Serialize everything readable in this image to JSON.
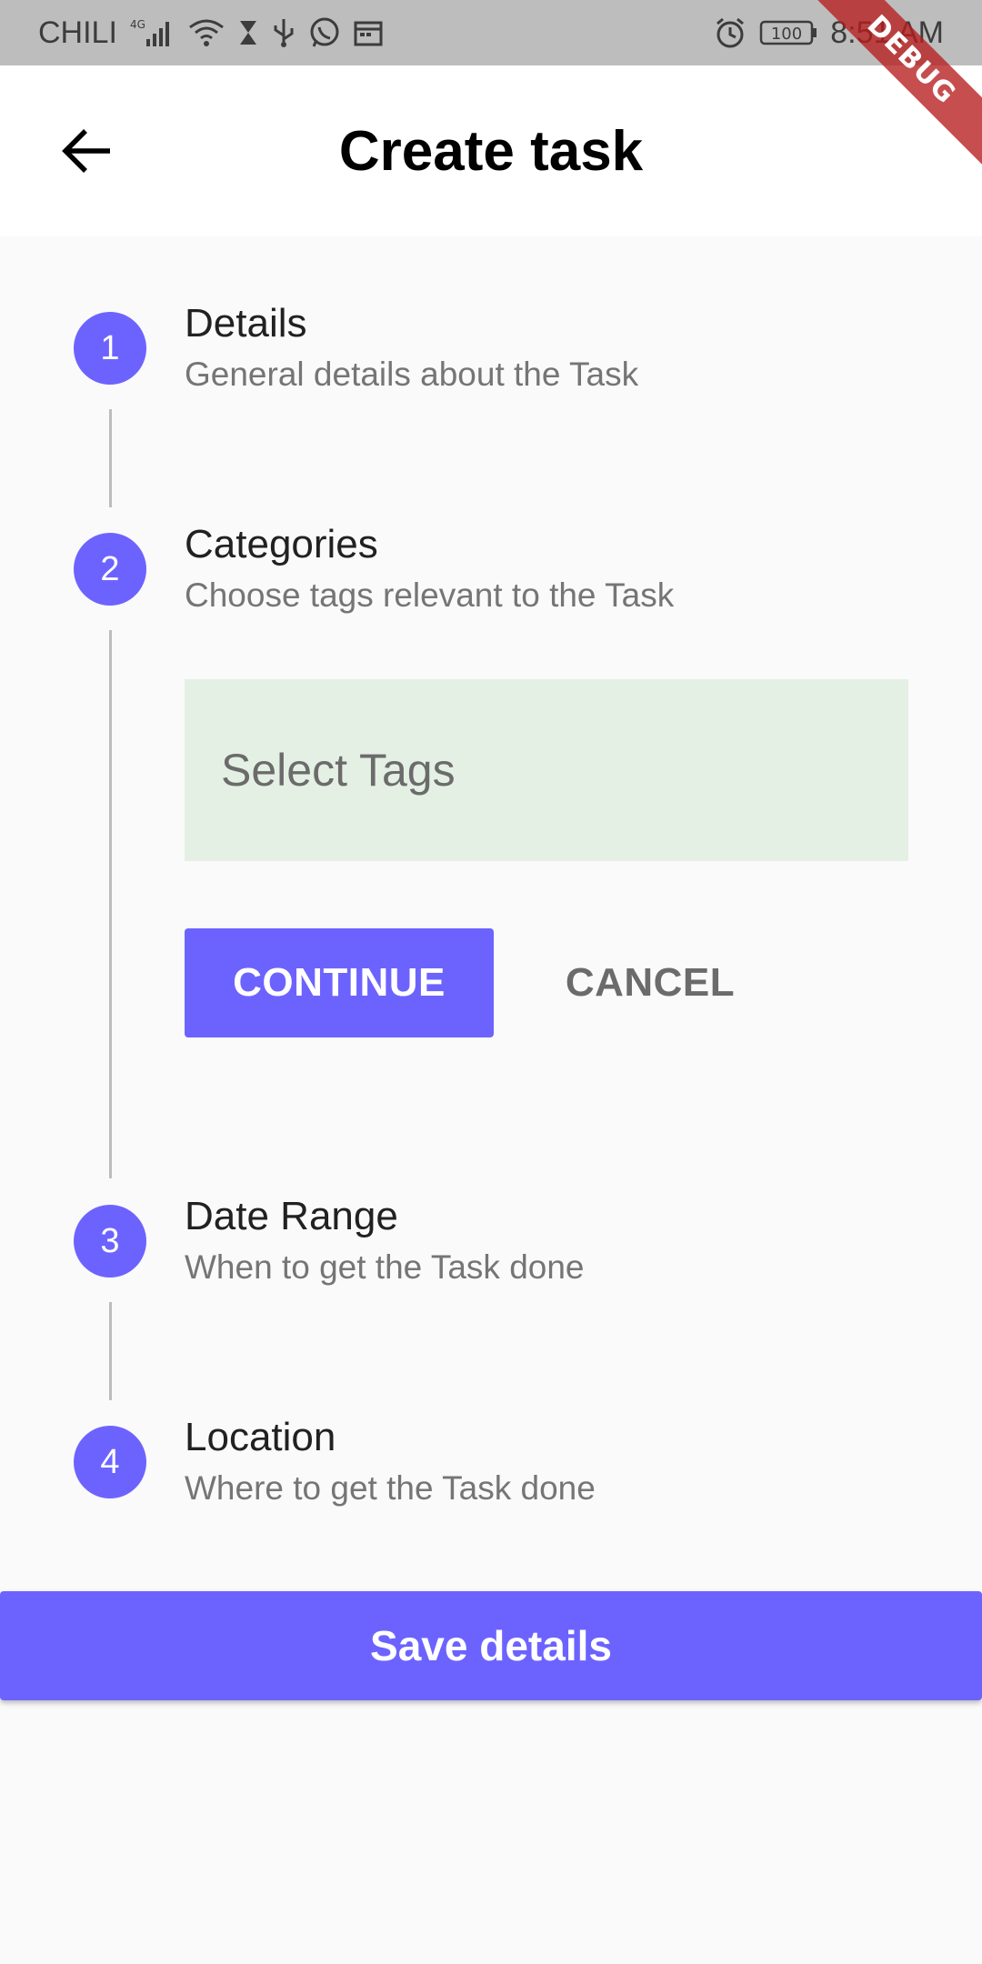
{
  "status_bar": {
    "carrier": "CHILI",
    "network": "4G",
    "battery": "100",
    "time": "8:51 AM"
  },
  "debug_banner": "DEBUG",
  "app_bar": {
    "title": "Create task"
  },
  "steps": [
    {
      "number": "1",
      "title": "Details",
      "subtitle": "General details about the Task"
    },
    {
      "number": "2",
      "title": "Categories",
      "subtitle": "Choose tags relevant to the Task"
    },
    {
      "number": "3",
      "title": "Date Range",
      "subtitle": "When to get the Task done"
    },
    {
      "number": "4",
      "title": "Location",
      "subtitle": "Where to get the Task done"
    }
  ],
  "tags_field": {
    "placeholder": "Select Tags"
  },
  "buttons": {
    "continue": "CONTINUE",
    "cancel": "CANCEL",
    "save": "Save details"
  },
  "colors": {
    "accent": "#6c63ff",
    "tag_field_bg": "#e5f0e5",
    "status_bar_bg": "#bdbdbd"
  }
}
